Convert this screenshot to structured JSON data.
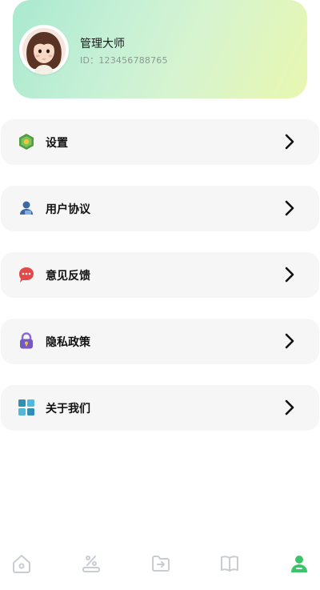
{
  "profile": {
    "name": "管理大师",
    "id_text": "ID：123456788765",
    "avatar": "avatar-girl"
  },
  "menu": {
    "items": [
      {
        "label": "设置",
        "icon": "settings-hexagon-icon",
        "color": "#5aa84a"
      },
      {
        "label": "用户协议",
        "icon": "user-icon",
        "color": "#3a6fb0"
      },
      {
        "label": "意见反馈",
        "icon": "chat-bubble-icon",
        "color": "#e54b4b"
      },
      {
        "label": "隐私政策",
        "icon": "lock-icon",
        "color": "#7a62c9"
      },
      {
        "label": "关于我们",
        "icon": "grid-blocks-icon",
        "color": "#3aa7c9"
      }
    ]
  },
  "tabbar": {
    "tabs": [
      {
        "icon": "home-icon",
        "active": false
      },
      {
        "icon": "percent-tag-icon",
        "active": false
      },
      {
        "icon": "folder-import-icon",
        "active": false
      },
      {
        "icon": "open-book-icon",
        "active": false
      },
      {
        "icon": "profile-icon",
        "active": true
      }
    ],
    "inactive_color": "#c9cdd2",
    "active_color": "#3cc46a"
  }
}
